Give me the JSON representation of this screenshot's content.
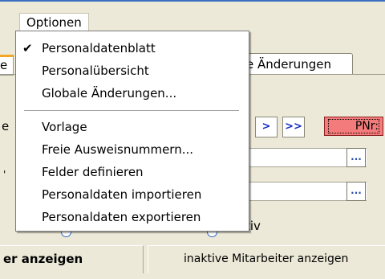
{
  "menubar": {
    "optionen_label": "Optionen"
  },
  "background": {
    "tab_left_fragment": "e",
    "tab_changes_label": "e Änderungen",
    "fragment_e": "e",
    "fragment_dot": "'",
    "nav_next": ">",
    "nav_last": ">>",
    "pnr_label": "PNr:",
    "ellipsis": "...",
    "fragment_tiv": "tiv",
    "bottom_left_label": "er anzeigen",
    "bottom_right_label": "inaktive Mitarbeiter anzeigen"
  },
  "dropdown": {
    "items": [
      {
        "label": "Personaldatenblatt",
        "checked": true,
        "check_glyph": "✔"
      },
      {
        "label": "Personalübersicht",
        "checked": false,
        "check_glyph": ""
      },
      {
        "label": "Globale Änderungen...",
        "checked": false,
        "check_glyph": ""
      },
      {
        "label": "Vorlage",
        "checked": false,
        "check_glyph": ""
      },
      {
        "label": "Freie Ausweisnummern...",
        "checked": false,
        "check_glyph": ""
      },
      {
        "label": "Felder definieren",
        "checked": false,
        "check_glyph": ""
      },
      {
        "label": "Personaldaten importieren",
        "checked": false,
        "check_glyph": ""
      },
      {
        "label": "Personaldaten exportieren",
        "checked": false,
        "check_glyph": ""
      }
    ]
  },
  "colors": {
    "pnr_bg": "#f47b7b",
    "nav_arrow": "#1a2fc0",
    "radio_ring": "#2f6bc8"
  }
}
